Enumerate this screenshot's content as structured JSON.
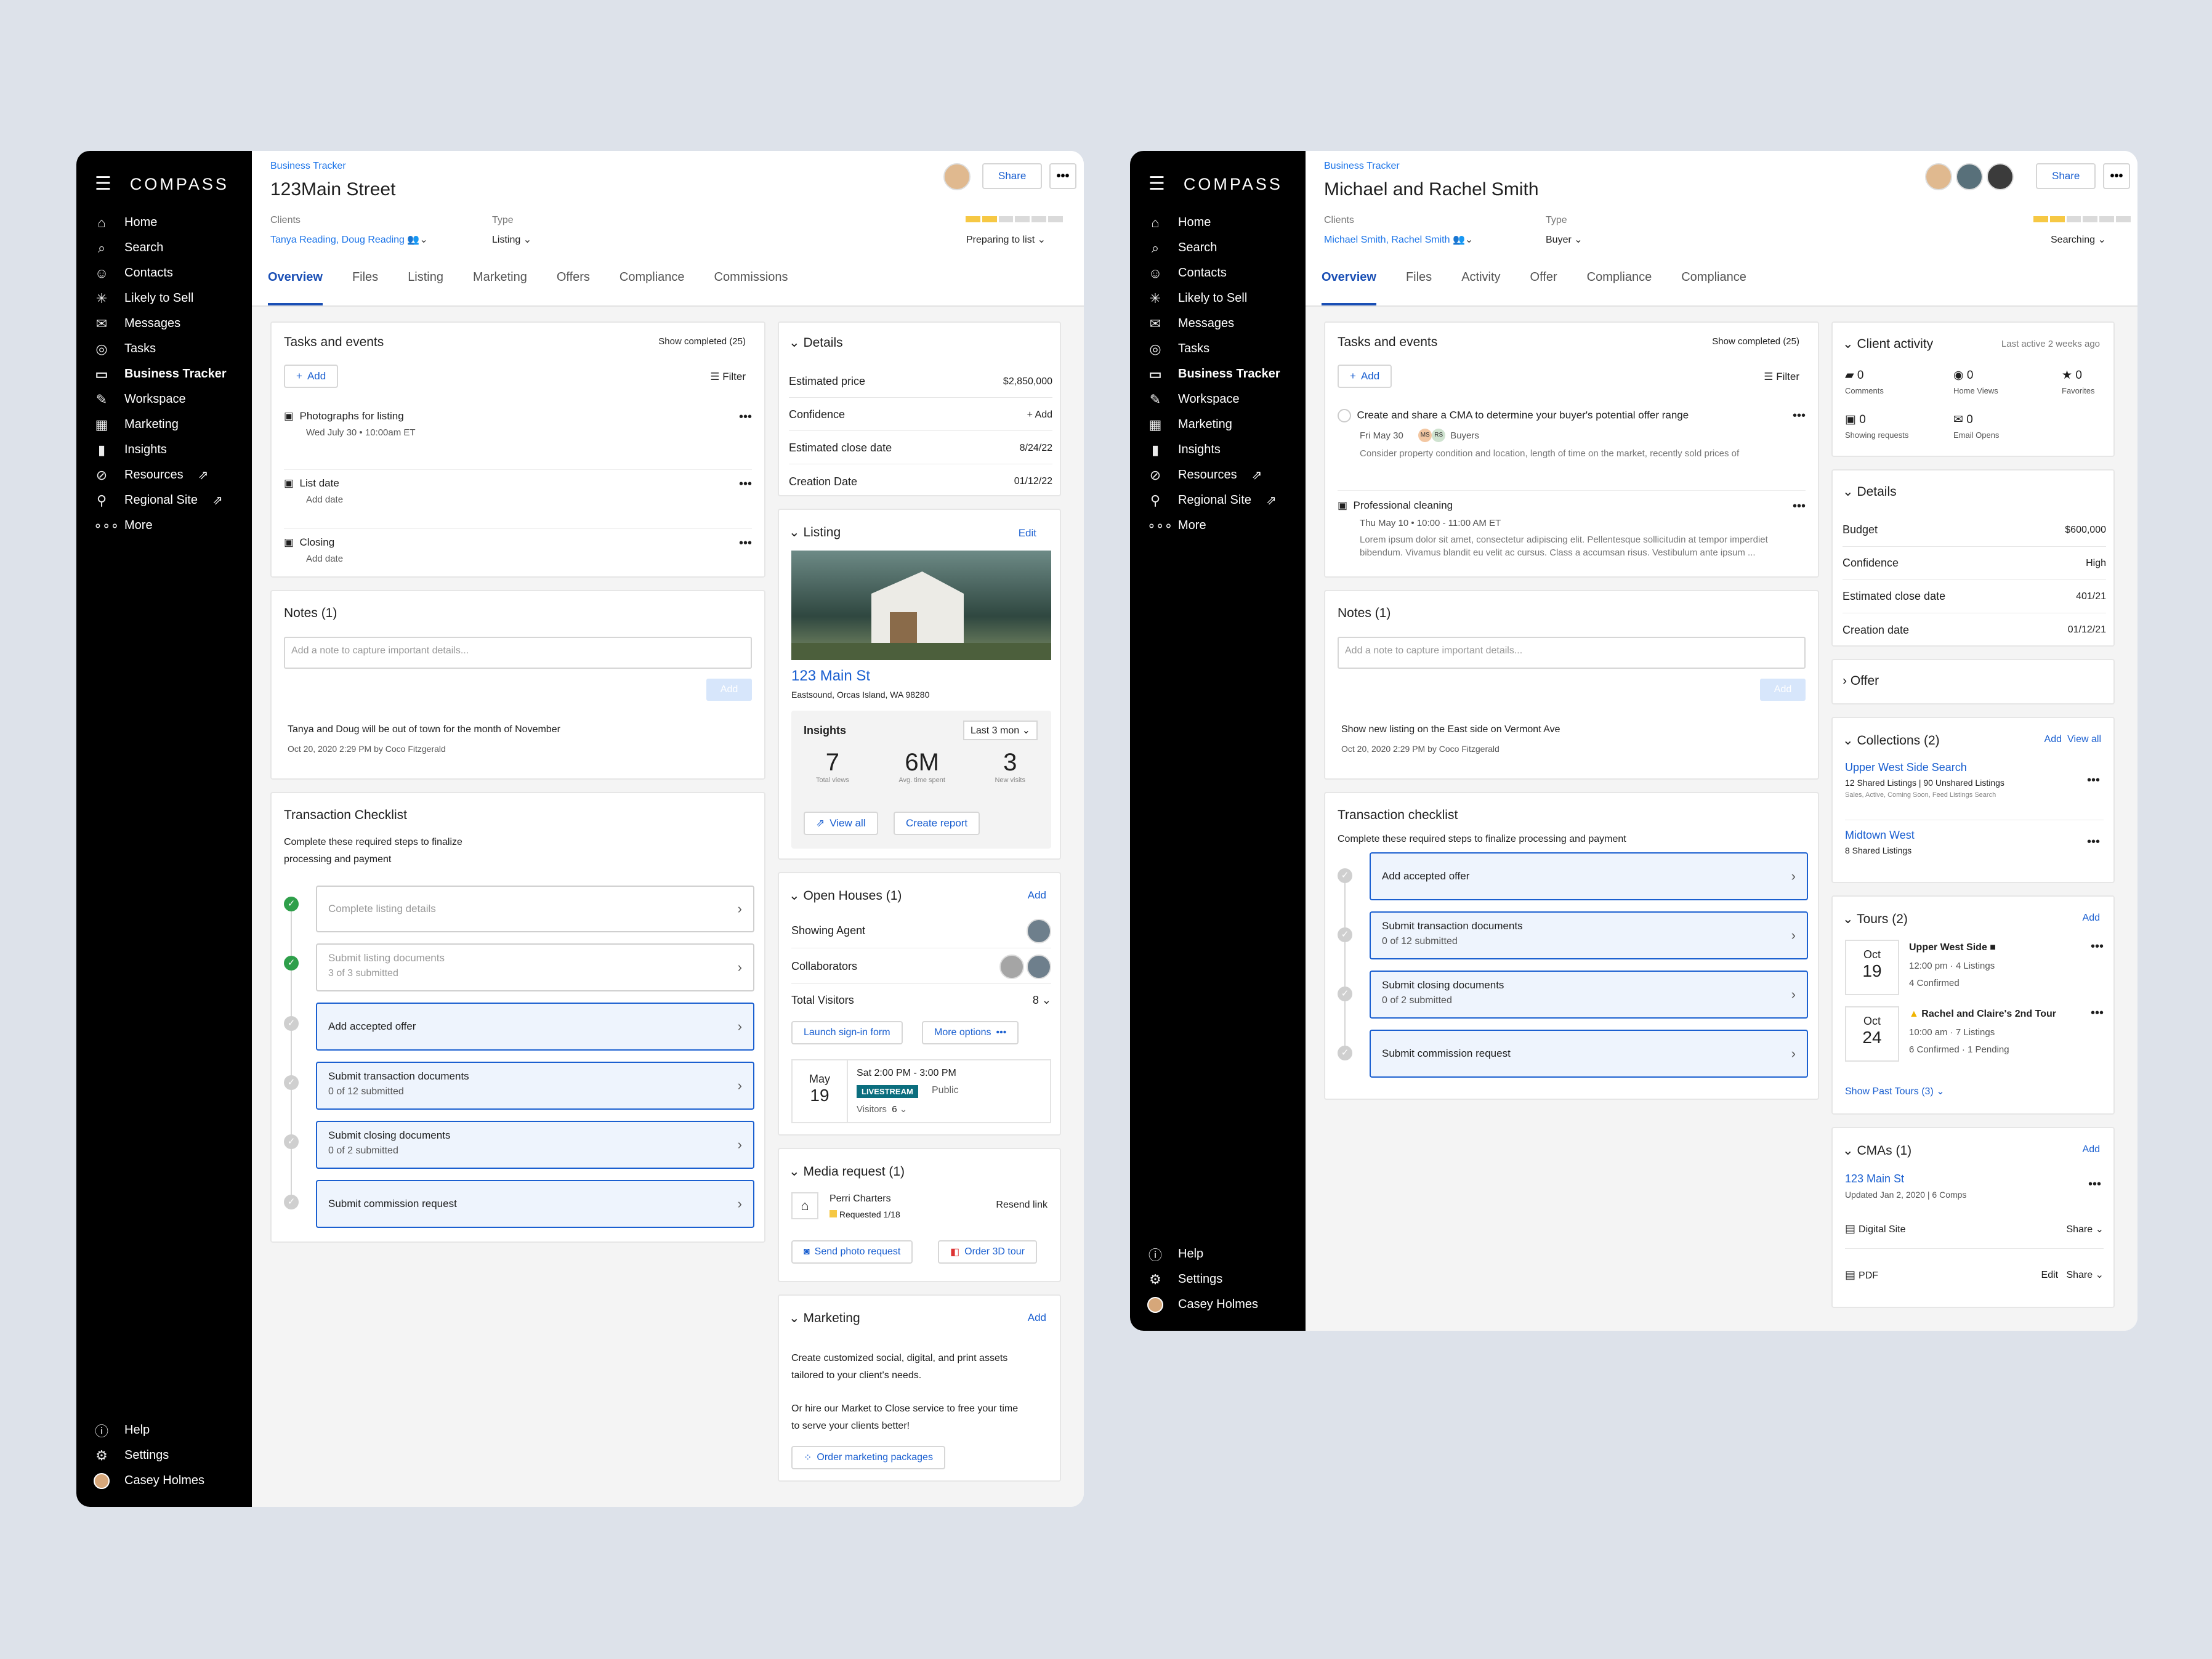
{
  "brand": "COMPASS",
  "nav": [
    "Home",
    "Search",
    "Contacts",
    "Likely to Sell",
    "Messages",
    "Tasks",
    "Business Tracker",
    "Workspace",
    "Marketing",
    "Insights",
    "Resources",
    "Regional Site",
    "More"
  ],
  "nav_bottom": [
    "Help",
    "Settings",
    "Casey Holmes"
  ],
  "colors": {
    "accent": "#1a5fd0",
    "progress": "#f6c844",
    "done": "#2e9f4a",
    "sidebar": "#000000"
  },
  "left": {
    "crumb": "Business Tracker",
    "title": "123Main Street",
    "clients_label": "Clients",
    "clients": "Tanya Reading, Doug Reading",
    "type_label": "Type",
    "type": "Listing",
    "stage": "Preparing to list",
    "share": "Share",
    "more": "•••",
    "tabs": [
      "Overview",
      "Files",
      "Listing",
      "Marketing",
      "Offers",
      "Compliance",
      "Commissions"
    ],
    "tasks": {
      "title": "Tasks and events",
      "show": "Show completed (25)",
      "add": "Add",
      "filter": "Filter",
      "items": [
        {
          "t": "Photographs for listing",
          "s": "Wed July 30  •  10:00am ET"
        },
        {
          "t": "List date",
          "s": "Add date"
        },
        {
          "t": "Closing",
          "s": "Add date"
        }
      ]
    },
    "notes": {
      "title": "Notes (1)",
      "placeholder": "Add a note to capture important details...",
      "add": "Add",
      "text": "Tanya and Doug will be out of town for the month of November",
      "meta": "Oct 20, 2020 2:29 PM by Coco Fitzgerald"
    },
    "checklist": {
      "title": "Transaction Checklist",
      "desc1": "Complete these required steps to finalize",
      "desc2": "processing and payment",
      "steps": [
        {
          "t": "Complete listing details",
          "s": ""
        },
        {
          "t": "Submit listing documents",
          "s": "3 of 3 submitted"
        },
        {
          "t": "Add accepted offer",
          "s": ""
        },
        {
          "t": "Submit transaction documents",
          "s": "0 of 12 submitted"
        },
        {
          "t": "Submit closing documents",
          "s": "0 of 2 submitted"
        },
        {
          "t": "Submit commission request",
          "s": ""
        }
      ]
    },
    "details": {
      "title": "Details",
      "rows": [
        [
          "Estimated price",
          "$2,850,000"
        ],
        [
          "Confidence",
          "+ Add"
        ],
        [
          "Estimated close date",
          "8/24/22"
        ],
        [
          "Creation Date",
          "01/12/22"
        ]
      ]
    },
    "listing": {
      "title": "Listing",
      "edit": "Edit",
      "addr": "123 Main St",
      "city": "Eastsound, Orcas Island, WA 98280",
      "insights": "Insights",
      "period": "Last 3 mon",
      "stats": [
        [
          "7",
          "Total views"
        ],
        [
          "6M",
          "Avg. time spent"
        ],
        [
          "3",
          "New visits"
        ]
      ],
      "view_all": "View all",
      "report": "Create report"
    },
    "open_houses": {
      "title": "Open Houses (1)",
      "add": "Add",
      "agent": "Showing Agent",
      "collab": "Collaborators",
      "visitors_label": "Total Visitors",
      "visitors": "8",
      "launch": "Launch sign-in form",
      "more": "More options",
      "month": "May",
      "day": "19",
      "time": "Sat 2:00 PM - 3:00 PM",
      "live": "LIVESTREAM",
      "pub": "Public",
      "vis": "Visitors",
      "vis_n": "6"
    },
    "media": {
      "title": "Media request (1)",
      "name": "Perri Charters",
      "req": "Requested 1/18",
      "resend": "Resend link",
      "photo": "Send photo request",
      "tour": "Order 3D tour"
    },
    "marketing": {
      "title": "Marketing",
      "add": "Add",
      "p1": "Create customized social, digital, and print assets",
      "p1b": "tailored to your client's needs.",
      "p2": "Or hire our Market to Close service to free your time",
      "p2b": "to serve your clients better!",
      "order": "Order marketing packages"
    }
  },
  "right": {
    "crumb": "Business Tracker",
    "title": "Michael and Rachel Smith",
    "clients_label": "Clients",
    "clients": "Michael Smith, Rachel Smith",
    "type_label": "Type",
    "type": "Buyer",
    "stage": "Searching",
    "share": "Share",
    "more": "•••",
    "tabs": [
      "Overview",
      "Files",
      "Activity",
      "Offer",
      "Compliance",
      "Compliance"
    ],
    "tasks": {
      "title": "Tasks and events",
      "show": "Show completed (25)",
      "add": "Add",
      "filter": "Filter",
      "i1": "Create and share a CMA to determine your buyer's potential offer range",
      "i1d": "Fri May 30",
      "i1b": "Buyers",
      "i1n": "Consider property condition and location, length of time on the market, recently sold prices of",
      "i2": "Professional cleaning",
      "i2d": "Thu May 10  •  10:00 - 11:00 AM ET",
      "i2n1": "Lorem ipsum dolor sit amet, consectetur adipiscing elit. Pellentesque sollicitudin at tempor imperdiet",
      "i2n2": "bibendum. Vivamus blandit eu velit ac cursus. Class a accumsan risus. Vestibulum ante ipsum ..."
    },
    "notes": {
      "title": "Notes (1)",
      "placeholder": "Add a note to capture important details...",
      "add": "Add",
      "text": "Show new listing on the East side on Vermont Ave",
      "meta": "Oct 20, 2020 2:29 PM by Coco Fitzgerald"
    },
    "checklist": {
      "title": "Transaction checklist",
      "desc": "Complete these required steps to finalize processing and payment",
      "steps": [
        {
          "t": "Add accepted offer",
          "s": ""
        },
        {
          "t": "Submit transaction documents",
          "s": "0 of 12 submitted"
        },
        {
          "t": "Submit closing documents",
          "s": "0 of 2 submitted"
        },
        {
          "t": "Submit commission request",
          "s": ""
        }
      ]
    },
    "activity": {
      "title": "Client activity",
      "last": "Last active 2 weeks ago",
      "stats": [
        [
          "0",
          "Comments"
        ],
        [
          "0",
          "Home Views"
        ],
        [
          "0",
          "Favorites"
        ],
        [
          "0",
          "Showing requests"
        ],
        [
          "0",
          "Email Opens"
        ]
      ]
    },
    "details": {
      "title": "Details",
      "rows": [
        [
          "Budget",
          "$600,000"
        ],
        [
          "Confidence",
          "High"
        ],
        [
          "Estimated close date",
          "401/21"
        ],
        [
          "Creation date",
          "01/12/21"
        ]
      ]
    },
    "offer": "Offer",
    "collections": {
      "title": "Collections (2)",
      "add": "Add",
      "view": "View all",
      "c1": "Upper West Side Search",
      "c1s": "12 Shared Listings  |  90 Unshared Listings",
      "c1t": "Sales, Active, Coming Soon, Feed Listings Search",
      "c2": "Midtown West",
      "c2s": "8 Shared Listings"
    },
    "tours": {
      "title": "Tours (2)",
      "add": "Add",
      "t1m": "Oct",
      "t1d": "19",
      "t1": "Upper West Side",
      "t1a": "12:00 pm · 4 Listings",
      "t1b": "4 Confirmed",
      "t2m": "Oct",
      "t2d": "24",
      "t2": "Rachel and Claire's 2nd Tour",
      "t2a": "10:00 am · 7 Listings",
      "t2b": "6 Confirmed · 1 Pending",
      "past": "Show Past Tours (3)"
    },
    "cmas": {
      "title": "CMAs (1)",
      "add": "Add",
      "name": "123 Main St",
      "meta": "Updated Jan 2, 2020  |  6 Comps",
      "digital": "Digital Site",
      "pdf": "PDF",
      "share": "Share",
      "edit": "Edit"
    }
  }
}
